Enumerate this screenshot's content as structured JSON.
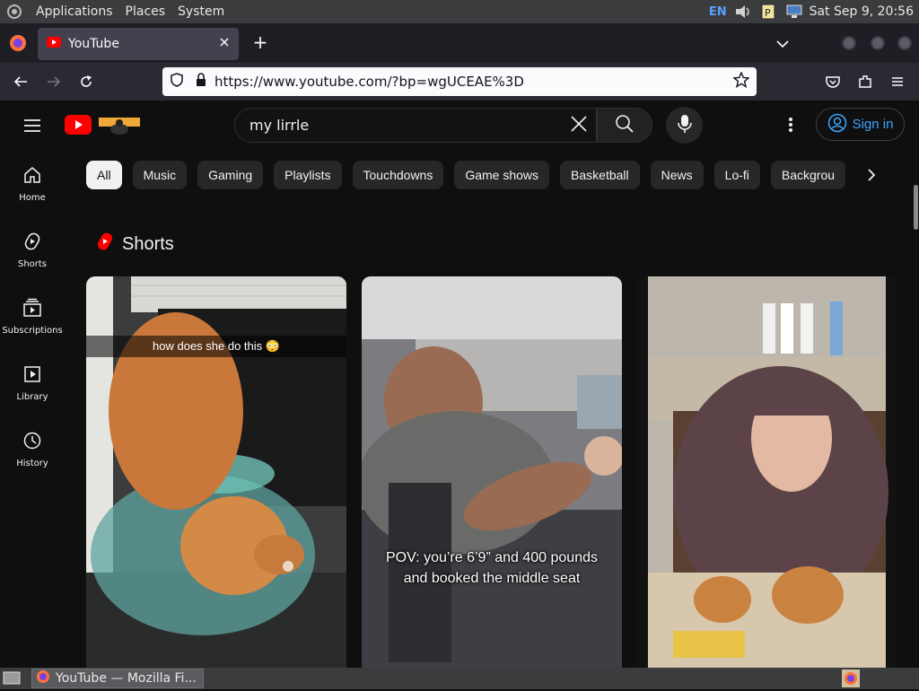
{
  "desktop": {
    "menu": [
      "Applications",
      "Places",
      "System"
    ],
    "lang": "EN",
    "clock": "Sat Sep  9, 20:56"
  },
  "browser": {
    "tab_title": "YouTube",
    "url": "https://www.youtube.com/?bp=wgUCEAE%3D"
  },
  "youtube": {
    "search_value": "my lirrle",
    "sign_in": "Sign in",
    "guide": [
      {
        "label": "Home",
        "icon": "home-icon"
      },
      {
        "label": "Shorts",
        "icon": "shorts-icon"
      },
      {
        "label": "Subscriptions",
        "icon": "subscriptions-icon"
      },
      {
        "label": "Library",
        "icon": "library-icon"
      },
      {
        "label": "History",
        "icon": "history-icon"
      }
    ],
    "chips": [
      "All",
      "Music",
      "Gaming",
      "Playlists",
      "Touchdowns",
      "Game shows",
      "Basketball",
      "News",
      "Lo-fi",
      "Backgrou"
    ],
    "shelf_title": "Shorts",
    "shorts": [
      {
        "caption": "how does she do this 😳"
      },
      {
        "caption": "POV: you’re 6’9” and 400 pounds and booked the middle seat"
      },
      {
        "caption": ""
      }
    ]
  },
  "taskbar": {
    "window_title": "YouTube — Mozilla Fi..."
  },
  "colors": {
    "yt_red": "#ff0000",
    "link_blue": "#3ea6ff",
    "bg": "#0f0f0f"
  }
}
